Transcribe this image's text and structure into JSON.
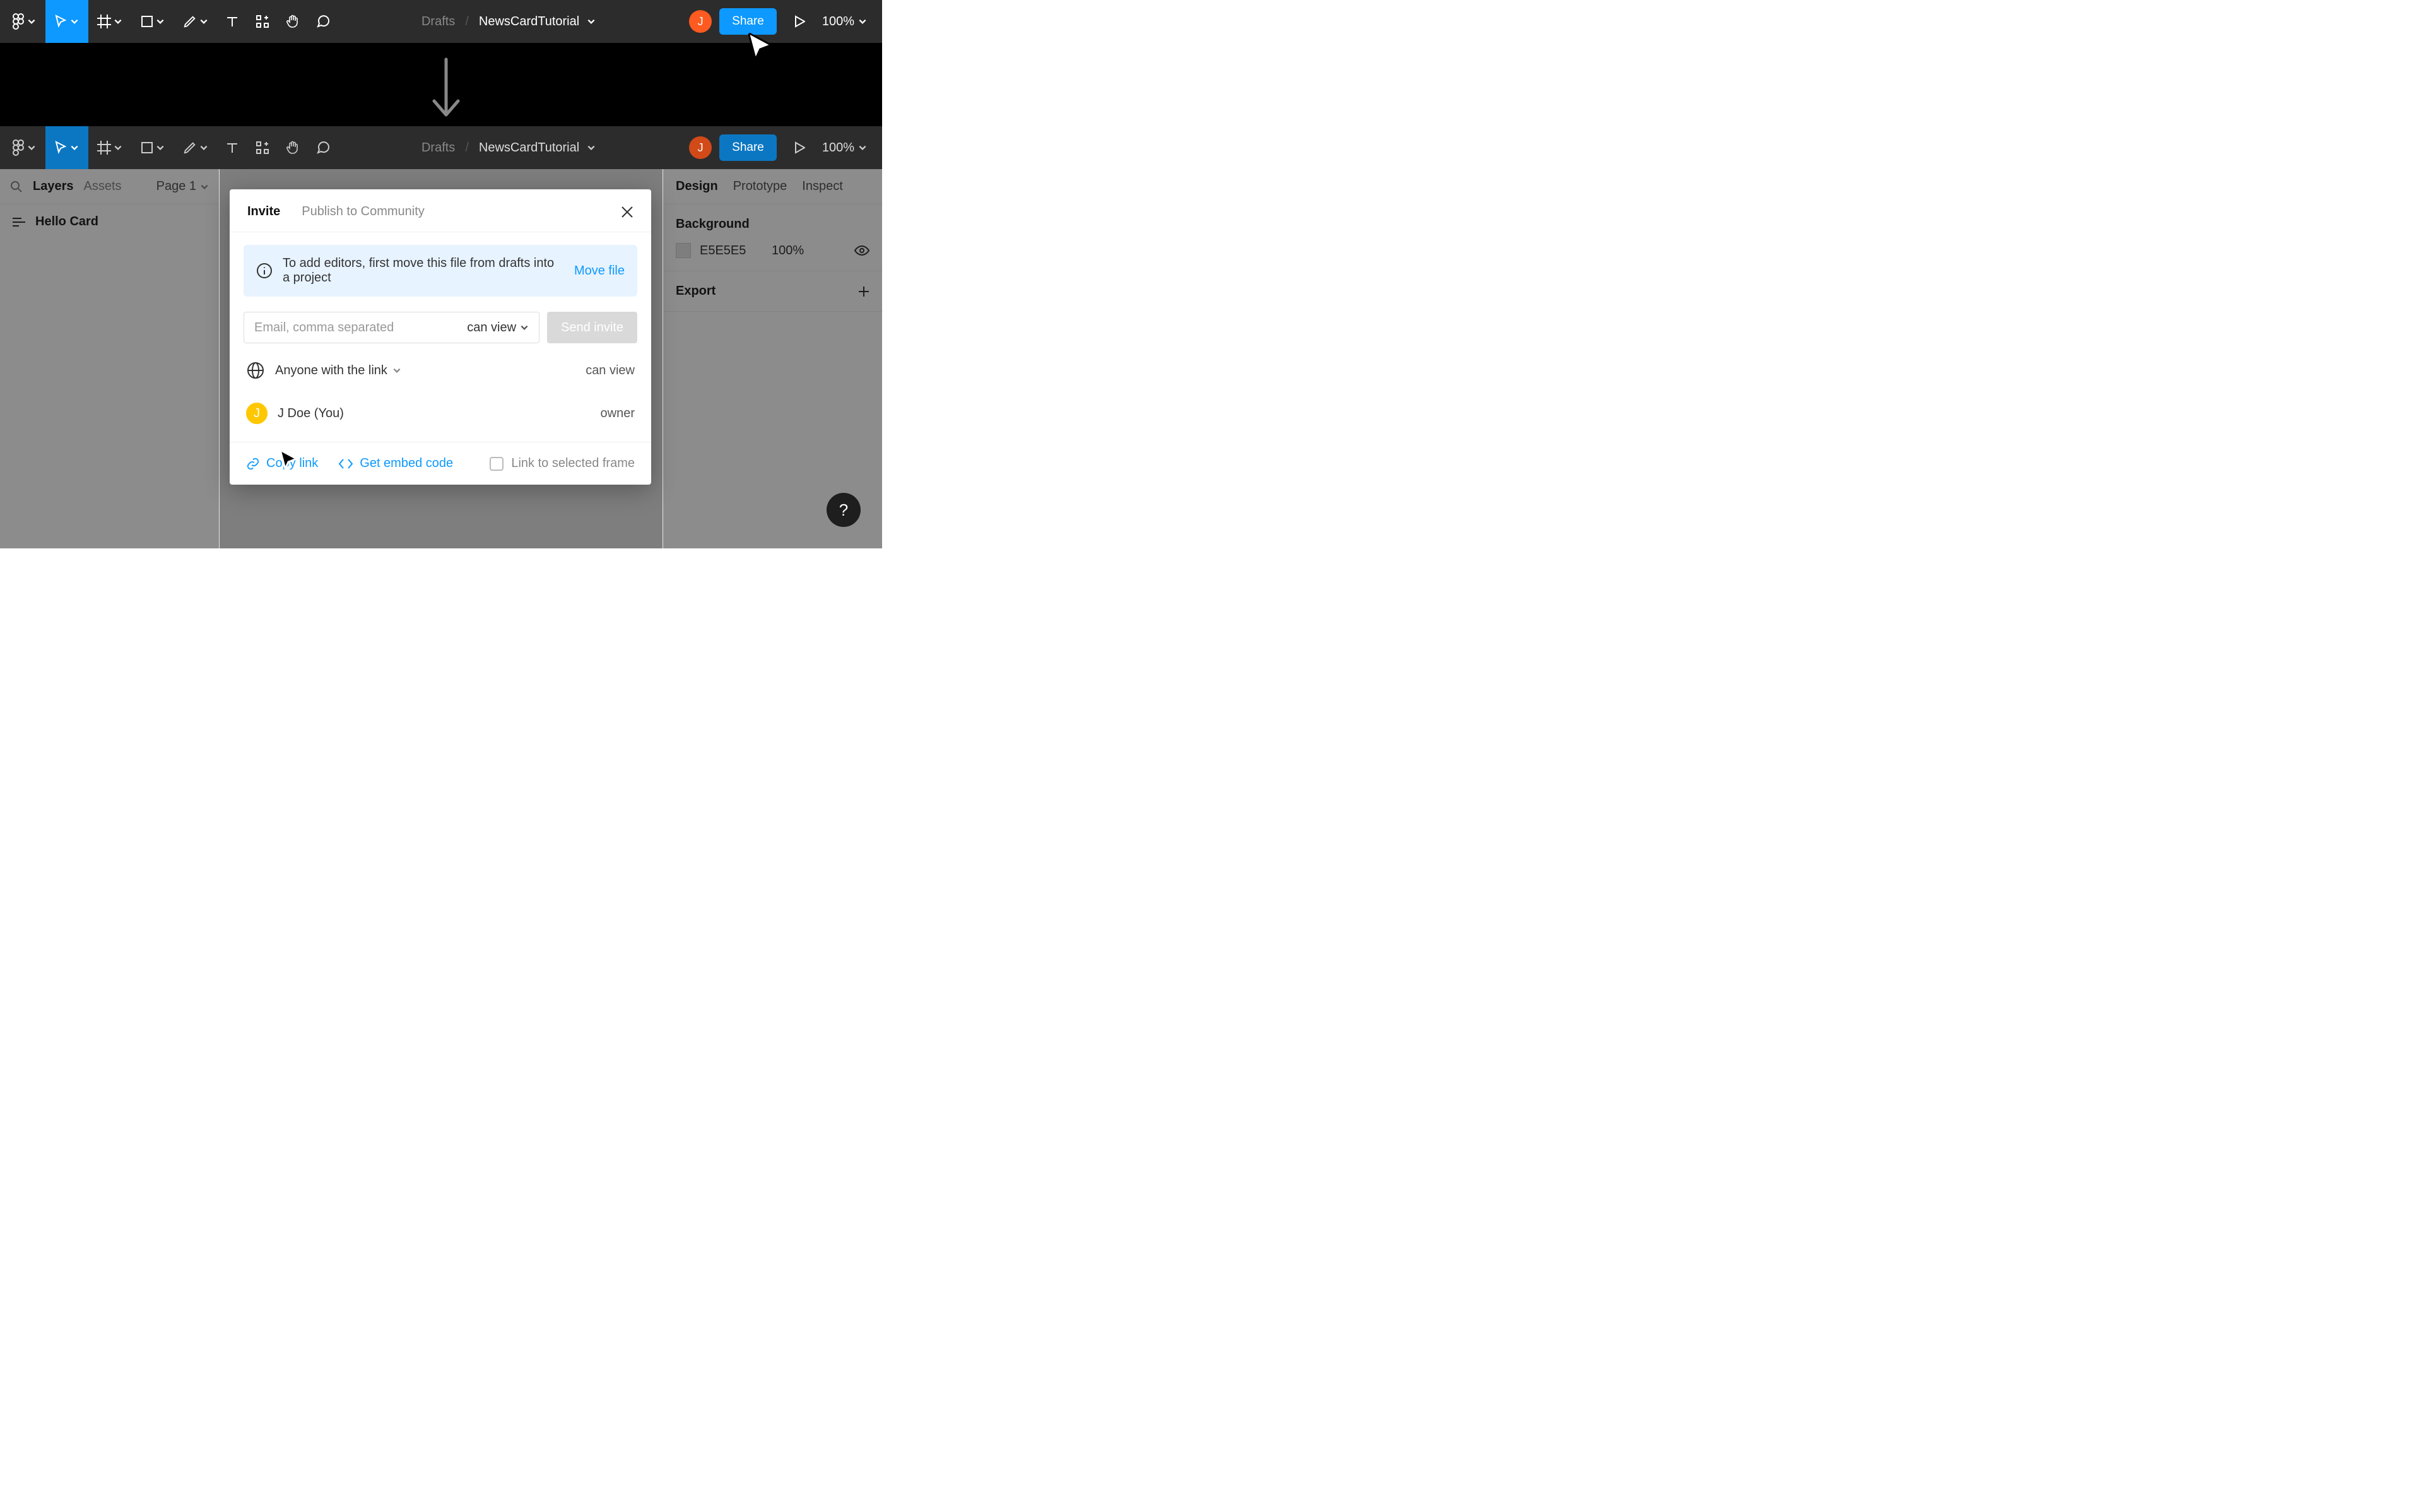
{
  "top_toolbar": {
    "breadcrumb_drafts": "Drafts",
    "breadcrumb_slash": "/",
    "breadcrumb_file": "NewsCardTutorial",
    "avatar_initial": "J",
    "share_label": "Share",
    "zoom_label": "100%"
  },
  "second_toolbar": {
    "breadcrumb_drafts": "Drafts",
    "breadcrumb_slash": "/",
    "breadcrumb_file": "NewsCardTutorial",
    "avatar_initial": "J",
    "share_label": "Share",
    "zoom_label": "100%"
  },
  "left_panel": {
    "layers_label": "Layers",
    "assets_label": "Assets",
    "page_label": "Page 1",
    "layer_name": "Hello Card"
  },
  "right_panel": {
    "tab_design": "Design",
    "tab_prototype": "Prototype",
    "tab_inspect": "Inspect",
    "bg_section": "Background",
    "bg_hex": "E5E5E5",
    "bg_opacity": "100%",
    "export_section": "Export"
  },
  "share_modal": {
    "tab_invite": "Invite",
    "tab_publish": "Publish to Community",
    "banner_text": "To add editors, first move this file from drafts into a project",
    "banner_action": "Move file",
    "email_placeholder": "Email, comma separated",
    "perm_label": "can view",
    "send_label": "Send invite",
    "anyone_label": "Anyone with the link",
    "anyone_role": "can view",
    "user_label": "J Doe (You)",
    "user_avatar_initial": "J",
    "user_role": "owner",
    "copy_link": "Copy link",
    "embed_code": "Get embed code",
    "frame_option": "Link to selected frame"
  },
  "help_fab": "?"
}
